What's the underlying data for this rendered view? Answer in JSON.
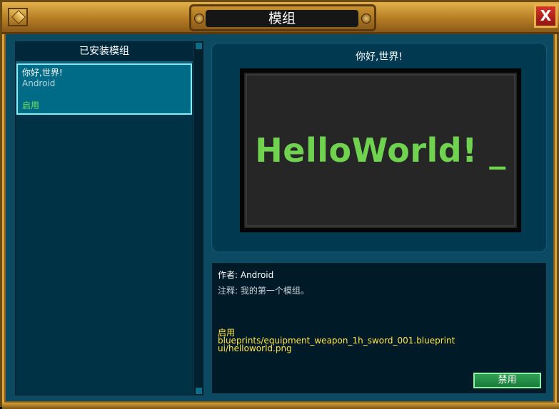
{
  "window": {
    "title": "模组",
    "close_label": "X"
  },
  "installed": {
    "header": "已安装模组",
    "items": [
      {
        "name": "你好,世界!",
        "author": "Android",
        "status": "启用"
      }
    ]
  },
  "preview": {
    "title": "你好,世界!",
    "image_text": "HelloWorld! _"
  },
  "details": {
    "author_line": "作者: Android",
    "note_line": "注释: 我的第一个模组。",
    "status": "启用",
    "files": [
      "blueprints/equipment_weapon_1h_sword_001.blueprint",
      "ui/helloworld.png"
    ],
    "disable_label": "禁用"
  },
  "colors": {
    "panel_bg": "#0b4a60",
    "accent_gold": "#d9a53a",
    "enabled_green": "#6fe05a",
    "file_yellow": "#ffe64a",
    "button_green": "#2fa252"
  }
}
